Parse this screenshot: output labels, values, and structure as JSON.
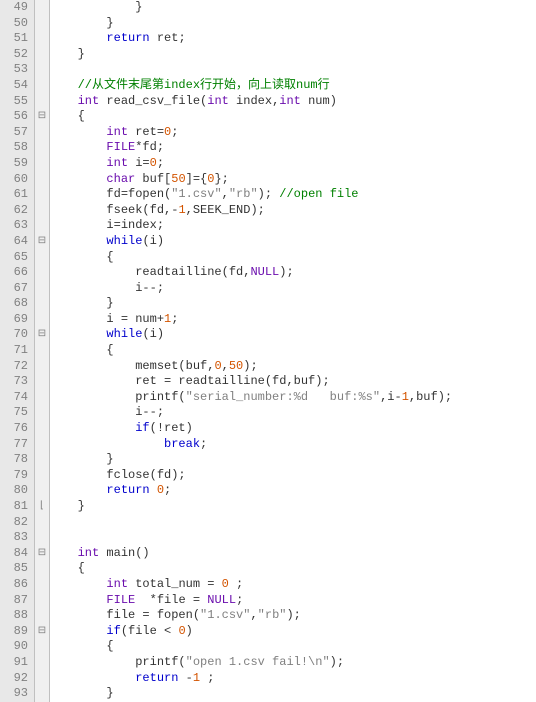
{
  "startLine": 49,
  "gutterLines": [
    "49",
    "50",
    "51",
    "52",
    "53",
    "54",
    "55",
    "56",
    "57",
    "58",
    "59",
    "60",
    "61",
    "62",
    "63",
    "64",
    "65",
    "66",
    "67",
    "68",
    "69",
    "70",
    "71",
    "72",
    "73",
    "74",
    "75",
    "76",
    "77",
    "78",
    "79",
    "80",
    "81",
    "82",
    "83",
    "84",
    "85",
    "86",
    "87",
    "88",
    "89",
    "90",
    "91",
    "92",
    "93"
  ],
  "foldMarks": [
    "",
    "",
    "",
    "",
    "",
    "",
    "",
    "⊟",
    "",
    "",
    "",
    "",
    "",
    "",
    "",
    "⊟",
    "",
    "",
    "",
    "",
    "",
    "⊟",
    "",
    "",
    "",
    "",
    "",
    "",
    "",
    "",
    "",
    "",
    "⌊",
    "",
    "",
    "⊟",
    "",
    "",
    "",
    "",
    "⊟",
    "",
    "",
    "",
    ""
  ],
  "code": [
    {
      "indent": 8,
      "tokens": [
        {
          "t": "}",
          "c": "c-punct"
        }
      ]
    },
    {
      "indent": 4,
      "tokens": [
        {
          "t": "}",
          "c": "c-punct"
        }
      ]
    },
    {
      "indent": 4,
      "tokens": [
        {
          "t": "return",
          "c": "c-keyword"
        },
        {
          "t": " ret;",
          "c": "c-ident"
        }
      ]
    },
    {
      "indent": 0,
      "tokens": [
        {
          "t": "}",
          "c": "c-punct"
        }
      ]
    },
    {
      "indent": 0,
      "tokens": []
    },
    {
      "indent": 0,
      "tokens": [
        {
          "t": "//从文件末尾第index行开始，向上读取num行",
          "c": "c-comment"
        }
      ]
    },
    {
      "indent": 0,
      "tokens": [
        {
          "t": "int",
          "c": "c-type"
        },
        {
          "t": " read_csv_file(",
          "c": "c-ident"
        },
        {
          "t": "int",
          "c": "c-type"
        },
        {
          "t": " index,",
          "c": "c-ident"
        },
        {
          "t": "int",
          "c": "c-type"
        },
        {
          "t": " num)",
          "c": "c-ident"
        }
      ]
    },
    {
      "indent": 0,
      "tokens": [
        {
          "t": "{",
          "c": "c-punct"
        }
      ]
    },
    {
      "indent": 4,
      "tokens": [
        {
          "t": "int",
          "c": "c-type"
        },
        {
          "t": " ret=",
          "c": "c-ident"
        },
        {
          "t": "0",
          "c": "c-num"
        },
        {
          "t": ";",
          "c": "c-punct"
        }
      ]
    },
    {
      "indent": 4,
      "tokens": [
        {
          "t": "FILE",
          "c": "c-macro"
        },
        {
          "t": "*fd;",
          "c": "c-ident"
        }
      ]
    },
    {
      "indent": 4,
      "tokens": [
        {
          "t": "int",
          "c": "c-type"
        },
        {
          "t": " i=",
          "c": "c-ident"
        },
        {
          "t": "0",
          "c": "c-num"
        },
        {
          "t": ";",
          "c": "c-punct"
        }
      ]
    },
    {
      "indent": 4,
      "tokens": [
        {
          "t": "char",
          "c": "c-type"
        },
        {
          "t": " buf[",
          "c": "c-ident"
        },
        {
          "t": "50",
          "c": "c-num"
        },
        {
          "t": "]={",
          "c": "c-ident"
        },
        {
          "t": "0",
          "c": "c-num"
        },
        {
          "t": "};",
          "c": "c-ident"
        }
      ]
    },
    {
      "indent": 4,
      "tokens": [
        {
          "t": "fd=fopen(",
          "c": "c-ident"
        },
        {
          "t": "\"1.csv\"",
          "c": "c-str"
        },
        {
          "t": ",",
          "c": "c-ident"
        },
        {
          "t": "\"rb\"",
          "c": "c-str"
        },
        {
          "t": "); ",
          "c": "c-ident"
        },
        {
          "t": "//open file",
          "c": "c-comment"
        }
      ]
    },
    {
      "indent": 4,
      "tokens": [
        {
          "t": "fseek(fd,-",
          "c": "c-ident"
        },
        {
          "t": "1",
          "c": "c-num"
        },
        {
          "t": ",SEEK_END);",
          "c": "c-ident"
        }
      ]
    },
    {
      "indent": 4,
      "tokens": [
        {
          "t": "i=index;",
          "c": "c-ident"
        }
      ]
    },
    {
      "indent": 4,
      "tokens": [
        {
          "t": "while",
          "c": "c-keyword"
        },
        {
          "t": "(i)",
          "c": "c-ident"
        }
      ]
    },
    {
      "indent": 4,
      "tokens": [
        {
          "t": "{",
          "c": "c-punct"
        }
      ]
    },
    {
      "indent": 8,
      "tokens": [
        {
          "t": "readtailline(fd,",
          "c": "c-ident"
        },
        {
          "t": "NULL",
          "c": "c-macro"
        },
        {
          "t": ");",
          "c": "c-ident"
        }
      ]
    },
    {
      "indent": 8,
      "tokens": [
        {
          "t": "i--;",
          "c": "c-ident"
        }
      ]
    },
    {
      "indent": 4,
      "tokens": [
        {
          "t": "}",
          "c": "c-punct"
        }
      ]
    },
    {
      "indent": 4,
      "tokens": [
        {
          "t": "i = num+",
          "c": "c-ident"
        },
        {
          "t": "1",
          "c": "c-num"
        },
        {
          "t": ";",
          "c": "c-ident"
        }
      ]
    },
    {
      "indent": 4,
      "tokens": [
        {
          "t": "while",
          "c": "c-keyword"
        },
        {
          "t": "(i)",
          "c": "c-ident"
        }
      ]
    },
    {
      "indent": 4,
      "tokens": [
        {
          "t": "{",
          "c": "c-punct"
        }
      ]
    },
    {
      "indent": 8,
      "tokens": [
        {
          "t": "memset(buf,",
          "c": "c-ident"
        },
        {
          "t": "0",
          "c": "c-num"
        },
        {
          "t": ",",
          "c": "c-ident"
        },
        {
          "t": "50",
          "c": "c-num"
        },
        {
          "t": ");",
          "c": "c-ident"
        }
      ]
    },
    {
      "indent": 8,
      "tokens": [
        {
          "t": "ret = readtailline(fd,buf);",
          "c": "c-ident"
        }
      ]
    },
    {
      "indent": 8,
      "tokens": [
        {
          "t": "printf(",
          "c": "c-ident"
        },
        {
          "t": "\"serial_number:%d   buf:%s\"",
          "c": "c-str"
        },
        {
          "t": ",i-",
          "c": "c-ident"
        },
        {
          "t": "1",
          "c": "c-num"
        },
        {
          "t": ",buf);",
          "c": "c-ident"
        }
      ]
    },
    {
      "indent": 8,
      "tokens": [
        {
          "t": "i--;",
          "c": "c-ident"
        }
      ]
    },
    {
      "indent": 8,
      "tokens": [
        {
          "t": "if",
          "c": "c-keyword"
        },
        {
          "t": "(!ret)",
          "c": "c-ident"
        }
      ]
    },
    {
      "indent": 12,
      "tokens": [
        {
          "t": "break",
          "c": "c-keyword"
        },
        {
          "t": ";",
          "c": "c-ident"
        }
      ]
    },
    {
      "indent": 4,
      "tokens": [
        {
          "t": "}",
          "c": "c-punct"
        }
      ]
    },
    {
      "indent": 4,
      "tokens": [
        {
          "t": "fclose(fd);",
          "c": "c-ident"
        }
      ]
    },
    {
      "indent": 4,
      "tokens": [
        {
          "t": "return",
          "c": "c-keyword"
        },
        {
          "t": " ",
          "c": "c-ident"
        },
        {
          "t": "0",
          "c": "c-num"
        },
        {
          "t": ";",
          "c": "c-ident"
        }
      ]
    },
    {
      "indent": 0,
      "tokens": [
        {
          "t": "}",
          "c": "c-punct"
        }
      ]
    },
    {
      "indent": 0,
      "tokens": []
    },
    {
      "indent": 0,
      "tokens": []
    },
    {
      "indent": 0,
      "tokens": [
        {
          "t": "int",
          "c": "c-type"
        },
        {
          "t": " main()",
          "c": "c-ident"
        }
      ]
    },
    {
      "indent": 0,
      "tokens": [
        {
          "t": "{",
          "c": "c-punct"
        }
      ]
    },
    {
      "indent": 4,
      "tokens": [
        {
          "t": "int",
          "c": "c-type"
        },
        {
          "t": " total_num = ",
          "c": "c-ident"
        },
        {
          "t": "0",
          "c": "c-num"
        },
        {
          "t": " ;",
          "c": "c-ident"
        }
      ]
    },
    {
      "indent": 4,
      "tokens": [
        {
          "t": "FILE",
          "c": "c-macro"
        },
        {
          "t": "  *file = ",
          "c": "c-ident"
        },
        {
          "t": "NULL",
          "c": "c-macro"
        },
        {
          "t": ";",
          "c": "c-ident"
        }
      ]
    },
    {
      "indent": 4,
      "tokens": [
        {
          "t": "file = fopen(",
          "c": "c-ident"
        },
        {
          "t": "\"1.csv\"",
          "c": "c-str"
        },
        {
          "t": ",",
          "c": "c-ident"
        },
        {
          "t": "\"rb\"",
          "c": "c-str"
        },
        {
          "t": ");",
          "c": "c-ident"
        }
      ]
    },
    {
      "indent": 4,
      "tokens": [
        {
          "t": "if",
          "c": "c-keyword"
        },
        {
          "t": "(file < ",
          "c": "c-ident"
        },
        {
          "t": "0",
          "c": "c-num"
        },
        {
          "t": ")",
          "c": "c-ident"
        }
      ]
    },
    {
      "indent": 4,
      "tokens": [
        {
          "t": "{",
          "c": "c-punct"
        }
      ]
    },
    {
      "indent": 8,
      "tokens": [
        {
          "t": "printf(",
          "c": "c-ident"
        },
        {
          "t": "\"open 1.csv fail!\\n\"",
          "c": "c-str"
        },
        {
          "t": ");",
          "c": "c-ident"
        }
      ]
    },
    {
      "indent": 8,
      "tokens": [
        {
          "t": "return",
          "c": "c-keyword"
        },
        {
          "t": " -",
          "c": "c-ident"
        },
        {
          "t": "1",
          "c": "c-num"
        },
        {
          "t": " ;",
          "c": "c-ident"
        }
      ]
    },
    {
      "indent": 4,
      "tokens": [
        {
          "t": "}",
          "c": "c-punct"
        }
      ]
    }
  ]
}
